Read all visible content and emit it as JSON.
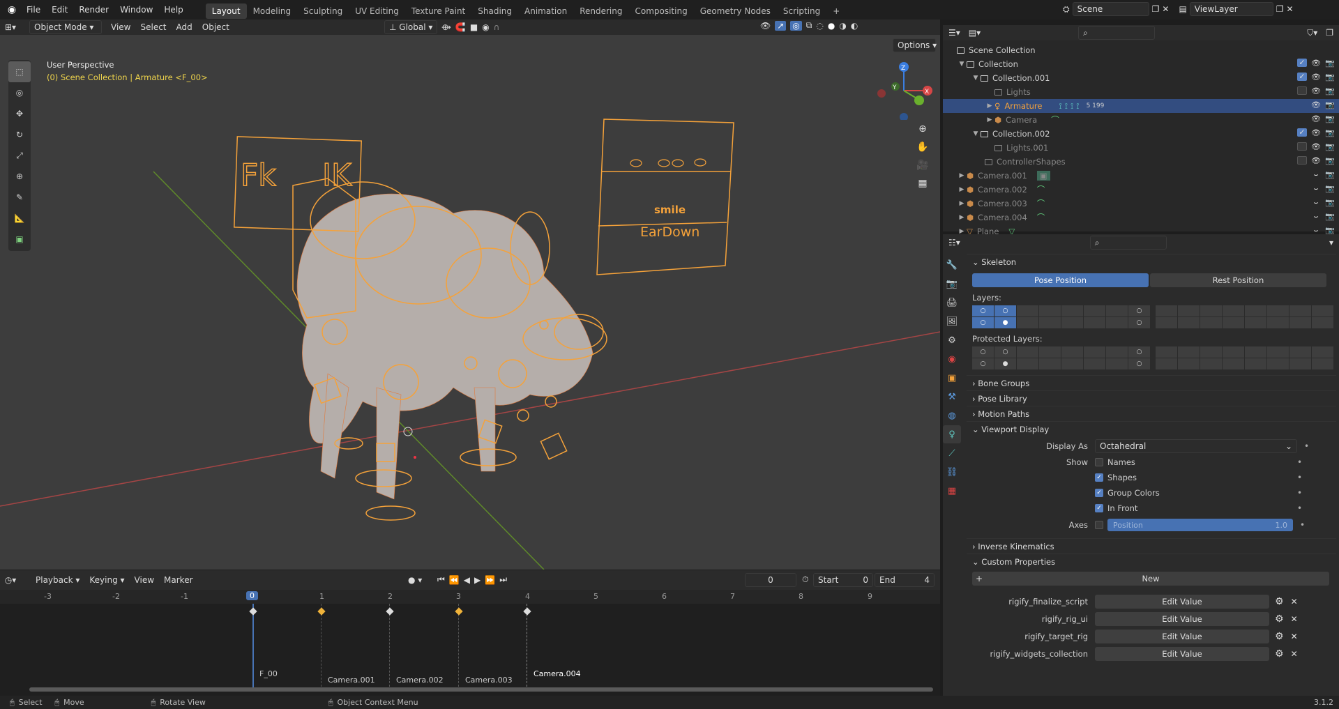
{
  "topbar": {
    "menus": [
      "File",
      "Edit",
      "Render",
      "Window",
      "Help"
    ],
    "workspaces": [
      "Layout",
      "Modeling",
      "Sculpting",
      "UV Editing",
      "Texture Paint",
      "Shading",
      "Animation",
      "Rendering",
      "Compositing",
      "Geometry Nodes",
      "Scripting"
    ],
    "active_workspace": "Layout",
    "add_workspace": "+",
    "scene": "Scene",
    "view_layer": "ViewLayer"
  },
  "viewport": {
    "mode": "Object Mode",
    "menus": [
      "View",
      "Select",
      "Add",
      "Object"
    ],
    "transform_orientation": "Global",
    "options": "Options",
    "title": "User Perspective",
    "subtitle": "(0) Scene Collection | Armature <F_00>",
    "overlay_text": {
      "fk": "Fk",
      "ik": "IK",
      "smile": "smile",
      "eardown": "EarDown"
    },
    "gizmo": {
      "x": "X",
      "y": "Y",
      "z": "Z"
    },
    "colors": {
      "accent": "#f5a23a",
      "bg": "#3d3d3d",
      "xaxis": "#b94848",
      "yaxis": "#6a9a2d"
    }
  },
  "timeline": {
    "menus": [
      "Playback",
      "Keying",
      "View",
      "Marker"
    ],
    "current_frame": "0",
    "start_label": "Start",
    "start": "0",
    "end_label": "End",
    "end": "4",
    "ticks": [
      "-3",
      "-2",
      "-1",
      "0",
      "1",
      "2",
      "3",
      "4",
      "5",
      "6",
      "7",
      "8",
      "9"
    ],
    "markers": [
      "F_00",
      "Camera.001",
      "Camera.002",
      "Camera.003",
      "Camera.004"
    ]
  },
  "outliner": {
    "root": "Scene Collection",
    "rows": [
      {
        "name": "Collection"
      },
      {
        "name": "Collection.001"
      },
      {
        "name": "Lights"
      },
      {
        "name": "Armature",
        "extra": "5  199"
      },
      {
        "name": "Camera"
      },
      {
        "name": "Collection.002"
      },
      {
        "name": "Lights.001"
      },
      {
        "name": "ControllerShapes"
      },
      {
        "name": "Camera.001"
      },
      {
        "name": "Camera.002"
      },
      {
        "name": "Camera.003"
      },
      {
        "name": "Camera.004"
      },
      {
        "name": "Plane"
      }
    ]
  },
  "properties": {
    "skeleton": "Skeleton",
    "pose_position": "Pose Position",
    "rest_position": "Rest Position",
    "layers": "Layers:",
    "protected_layers": "Protected Layers:",
    "bone_groups": "Bone Groups",
    "pose_library": "Pose Library",
    "motion_paths": "Motion Paths",
    "viewport_display": "Viewport Display",
    "display_as_label": "Display As",
    "display_as": "Octahedral",
    "show_label": "Show",
    "names": "Names",
    "shapes": "Shapes",
    "group_colors": "Group Colors",
    "in_front": "In Front",
    "axes_label": "Axes",
    "position_label": "Position",
    "position_value": "1.0",
    "inverse_kinematics": "Inverse Kinematics",
    "custom_properties": "Custom Properties",
    "new_button": "New",
    "edit_value": "Edit Value",
    "custom_props": [
      "rigify_finalize_script",
      "rigify_rig_ui",
      "rigify_target_rig",
      "rigify_widgets_collection"
    ]
  },
  "statusbar": {
    "select": "Select",
    "move": "Move",
    "rotate": "Rotate View",
    "context": "Object Context Menu",
    "version": "3.1.2"
  }
}
